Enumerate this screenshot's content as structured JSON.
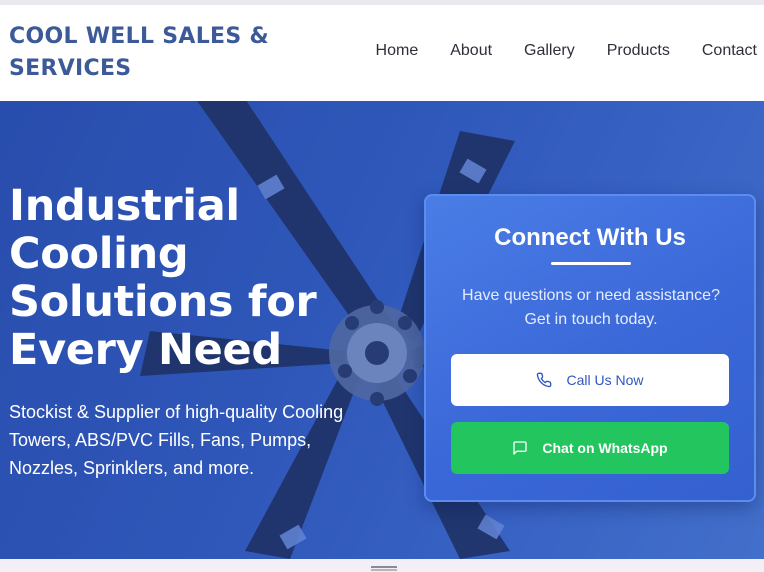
{
  "brand": {
    "line1": "COOL WELL SALES &",
    "line2": "SERVICES"
  },
  "nav": {
    "items": [
      {
        "label": "Home"
      },
      {
        "label": "About"
      },
      {
        "label": "Gallery"
      },
      {
        "label": "Products"
      },
      {
        "label": "Contact"
      }
    ]
  },
  "hero": {
    "title_lines": [
      "Industrial",
      "Cooling",
      "Solutions for",
      "Every Need"
    ],
    "subtitle_lines": [
      "Stockist & Supplier of high-quality Cooling",
      "Towers, ABS/PVC Fills, Fans, Pumps,",
      "Nozzles, Sprinklers, and more."
    ]
  },
  "contact_card": {
    "title": "Connect With Us",
    "text_lines": [
      "Have questions or need assistance?",
      "Get in touch today."
    ],
    "call_label": "Call Us Now",
    "whatsapp_label": "Chat on WhatsApp"
  },
  "icons": {
    "call": "phone-icon",
    "whatsapp": "chat-bubble-icon",
    "scroll": "menu-handle-icon"
  },
  "colors": {
    "brand": "#3c5a98",
    "hero_blue": "#3159b9",
    "card_blue": "#4a7de6",
    "whatsapp_green": "#22c55e"
  }
}
